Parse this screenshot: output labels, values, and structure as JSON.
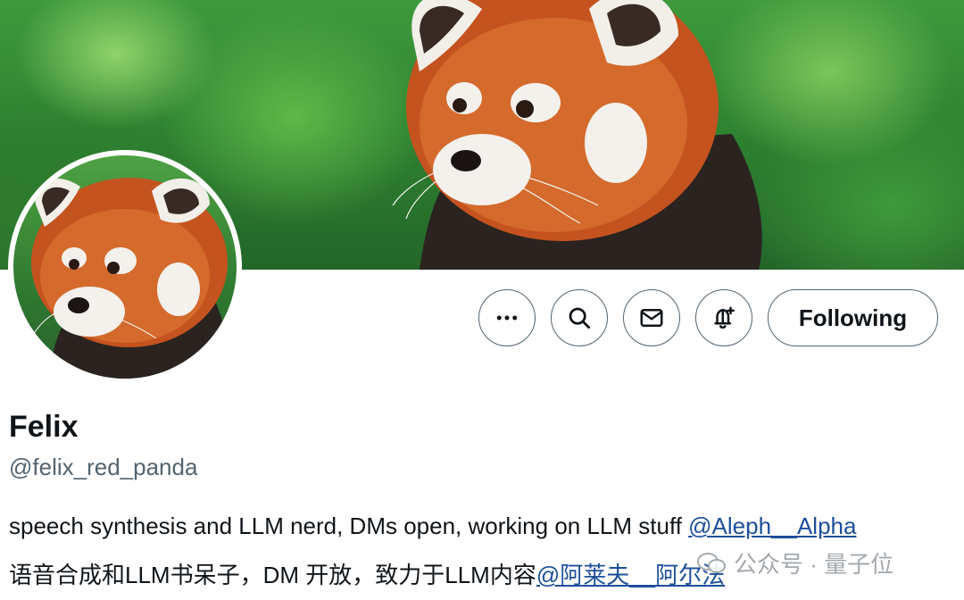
{
  "profile": {
    "display_name": "Felix",
    "handle": "@felix_red_panda",
    "bio_line1_text": "speech synthesis and LLM nerd, DMs open, working on LLM stuff ",
    "bio_line1_mention": "@Aleph__Alpha",
    "bio_line2_text": "语音合成和LLM书呆子，DM 开放，致力于LLM内容",
    "bio_line2_mention": "@阿莱夫__阿尔法"
  },
  "actions": {
    "more": "more-icon",
    "search": "search-icon",
    "message": "envelope-icon",
    "notify": "bell-plus-icon",
    "follow_label": "Following"
  },
  "watermark": {
    "text": "公众号 · 量子位"
  },
  "colors": {
    "text_primary": "#0f1419",
    "text_secondary": "#536471",
    "link": "#1d4f9a",
    "border": "#536471"
  }
}
